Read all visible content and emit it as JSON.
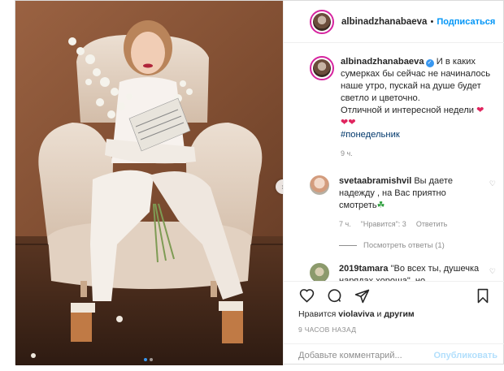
{
  "header": {
    "username": "albinadzhanabaeva",
    "separator": "•",
    "follow_label": "Подписаться"
  },
  "caption": {
    "username": "albinadzhanabaeva",
    "text": " И в каких сумерках бы сейчас не начиналось наше утро, пускай на душе будет светло и цветочно.",
    "text2": "Отличной и интересной недели ",
    "hearts1": "❤",
    "hearts2": "❤❤",
    "hashtag": "#понедельник",
    "time": "9 ч."
  },
  "comments": [
    {
      "username": "svetaabramishvil",
      "text": " Вы даете надежду , на Вас приятно смотреть",
      "emoji": "☘",
      "time": "7 ч.",
      "likes": "\"Нравится\": 3",
      "reply": "Ответить",
      "view_replies": "Посмотреть ответы (1)"
    },
    {
      "username": "2019tamara",
      "text": " \"Во всех ты, душечка нарядах хороша\", но"
    }
  ],
  "actions": {
    "likes_prefix": "Нравится ",
    "liker": "violaviva",
    "likes_and": " и ",
    "likes_others": "другим",
    "post_time": "9 ЧАСОВ НАЗАД",
    "comment_placeholder": "Добавьте комментарий...",
    "publish_label": "Опубликовать"
  },
  "colors": {
    "accent": "#0095f6",
    "heart": "#e0245e",
    "muted": "#8e8e8e",
    "text": "#262626"
  },
  "icons": [
    "heart-icon",
    "comment-icon",
    "share-icon",
    "bookmark-icon",
    "chevron-right-icon",
    "verified-icon",
    "like-small-icon"
  ]
}
